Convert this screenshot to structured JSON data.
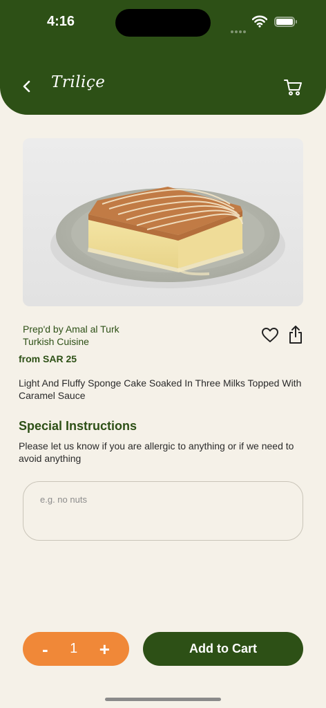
{
  "status_bar": {
    "time": "4:16"
  },
  "header": {
    "brand": "Triliçe",
    "icons": {
      "back": "chevron-left-icon",
      "cart": "cart-icon"
    }
  },
  "product": {
    "image": "tres-leches-cake-image",
    "prep_line": "Prep'd by Amal al Turk",
    "cuisine": "Turkish Cuisine",
    "price": "from SAR 25",
    "description": "Light And Fluffy Sponge Cake Soaked In Three Milks Topped With Caramel Sauce"
  },
  "special_instructions": {
    "title": "Special Instructions",
    "text": "Please let us know if you are allergic to anything or if we need to avoid anything",
    "placeholder": "e.g. no nuts",
    "value": ""
  },
  "footer": {
    "minus": "-",
    "quantity": "1",
    "plus": "+",
    "add_to_cart": "Add to Cart"
  },
  "colors": {
    "primary": "#2d5016",
    "accent": "#f08838",
    "background": "#f5f1e8"
  }
}
